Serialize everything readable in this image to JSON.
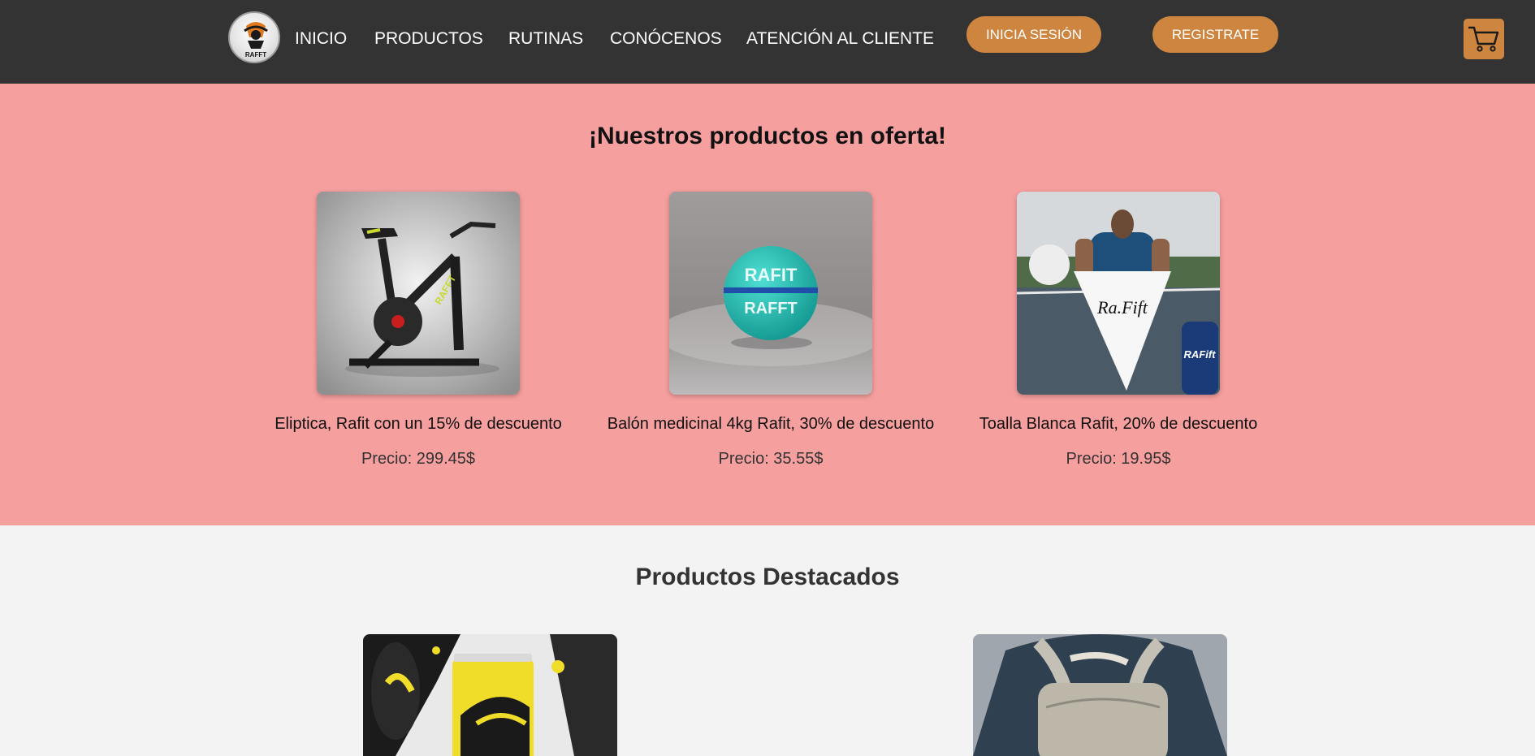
{
  "header": {
    "nav": [
      "INICIO",
      "PRODUCTOS",
      "RUTINAS",
      "CONÓCENOS",
      "ATENCIÓN AL CLIENTE"
    ],
    "login_label": "INICIA SESIÓN",
    "register_label": "REGISTRATE",
    "logo_text": "RAFFT",
    "cart_icon": "shopping-cart-icon"
  },
  "offers": {
    "title": "¡Nuestros productos en oferta!",
    "items": [
      {
        "name": "Eliptica, Rafit con un 15% de descuento",
        "price": "Precio: 299.45$"
      },
      {
        "name": "Balón medicinal 4kg Rafit, 30% de descuento",
        "price": "Precio: 35.55$"
      },
      {
        "name": "Toalla Blanca Rafit, 20% de descuento",
        "price": "Precio: 19.95$"
      }
    ]
  },
  "featured": {
    "title": "Productos Destacados"
  },
  "colors": {
    "header_bg": "#333333",
    "accent": "#cd853f",
    "offers_bg": "#f69f9f",
    "page_bg": "#f3f3f3"
  }
}
